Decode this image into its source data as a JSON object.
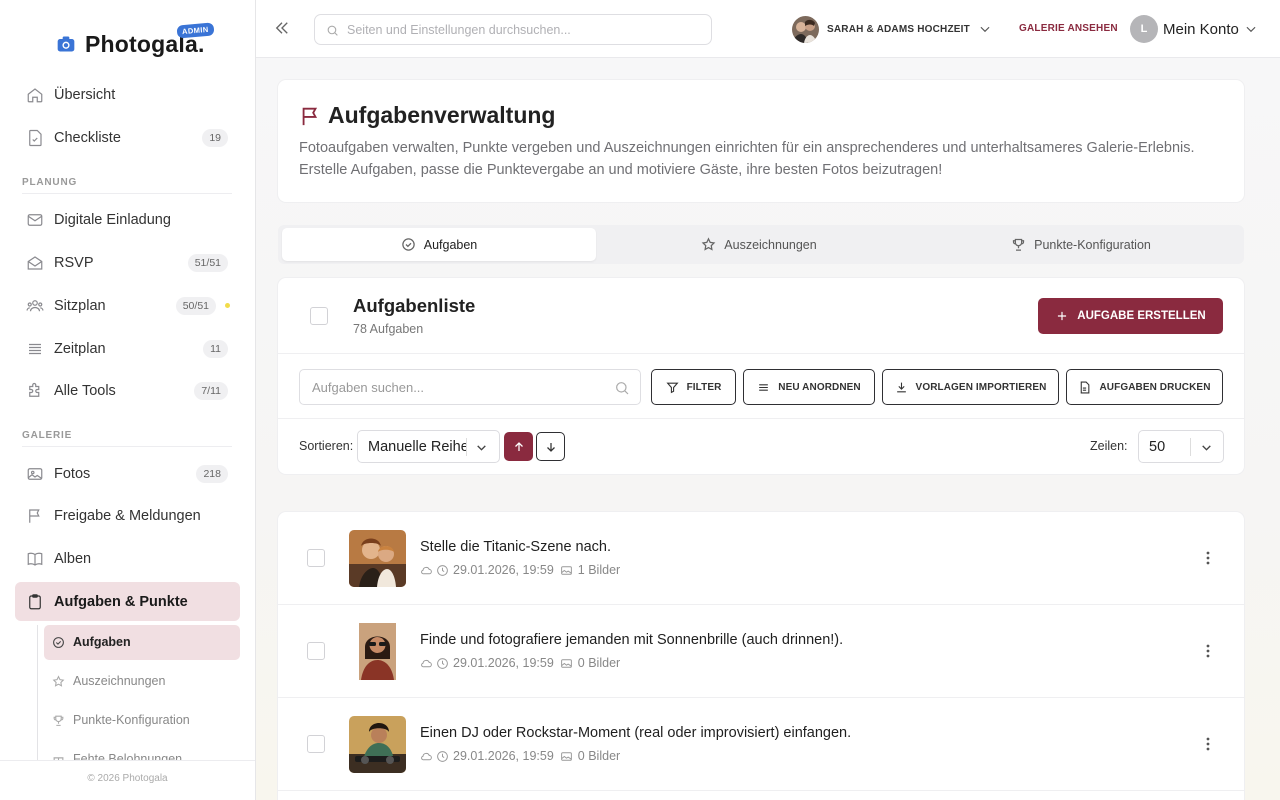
{
  "brand": {
    "name": "Photogala.",
    "badge": "ADMIN"
  },
  "sidebar": {
    "items_top": [
      {
        "label": "Übersicht",
        "icon": "home-icon"
      },
      {
        "label": "Checkliste",
        "icon": "checklist-icon",
        "count": "19"
      }
    ],
    "section_planung": "PLANUNG",
    "items_planung": [
      {
        "label": "Digitale Einladung",
        "icon": "mail-icon"
      },
      {
        "label": "RSVP",
        "icon": "envelope-open-icon",
        "count": "51/51"
      },
      {
        "label": "Sitzplan",
        "icon": "users-icon",
        "count": "50/51"
      },
      {
        "label": "Zeitplan",
        "icon": "list-icon",
        "count": "11"
      },
      {
        "label": "Alle Tools",
        "icon": "puzzle-icon",
        "count": "7/11"
      }
    ],
    "section_galerie": "GALERIE",
    "items_galerie": [
      {
        "label": "Fotos",
        "icon": "image-icon",
        "count": "218"
      },
      {
        "label": "Freigabe & Meldungen",
        "icon": "flag-icon"
      },
      {
        "label": "Alben",
        "icon": "book-icon"
      },
      {
        "label": "Aufgaben & Punkte",
        "icon": "clipboard-icon"
      }
    ],
    "sub_items": [
      {
        "label": "Aufgaben",
        "icon": "check-circle-icon"
      },
      {
        "label": "Auszeichnungen",
        "icon": "star-icon"
      },
      {
        "label": "Punkte-Konfiguration",
        "icon": "trophy-icon"
      },
      {
        "label": "Fehte Belohnungen",
        "icon": "gift-icon"
      }
    ],
    "footer": "© 2026 Photogala"
  },
  "header": {
    "search_placeholder": "Seiten und Einstellungen durchsuchen...",
    "event_name": "SARAH & ADAMS HOCHZEIT",
    "view_gallery": "GALERIE ANSEHEN",
    "account_initial": "L",
    "account_label": "Mein Konto"
  },
  "intro": {
    "title": "Aufgabenverwaltung",
    "description": "Fotoaufgaben verwalten, Punkte vergeben und Auszeichnungen einrichten für ein ansprechenderes und unterhaltsameres Galerie-Erlebnis. Erstelle Aufgaben, passe die Punktevergabe an und motiviere Gäste, ihre besten Fotos beizutragen!"
  },
  "tabs": [
    {
      "label": "Aufgaben",
      "icon": "check-circle-icon"
    },
    {
      "label": "Auszeichnungen",
      "icon": "star-icon"
    },
    {
      "label": "Punkte-Konfiguration",
      "icon": "trophy-icon"
    }
  ],
  "list": {
    "title": "Aufgabenliste",
    "count_text": "78 Aufgaben",
    "create_label": "AUFGABE ERSTELLEN",
    "search_placeholder": "Aufgaben suchen...",
    "buttons": {
      "filter": "FILTER",
      "reorder": "NEU ANORDNEN",
      "import": "VORLAGEN IMPORTIEREN",
      "print": "AUFGABEN DRUCKEN"
    },
    "sort_label": "Sortieren:",
    "sort_value": "Manuelle Reihenfolge",
    "rows_label": "Zeilen:",
    "rows_value": "50"
  },
  "tasks": [
    {
      "title": "Stelle die Titanic-Szene nach.",
      "date": "29.01.2026, 19:59",
      "images": "1 Bilder"
    },
    {
      "title": "Finde und fotografiere jemanden mit Sonnenbrille (auch drinnen!).",
      "date": "29.01.2026, 19:59",
      "images": "0 Bilder"
    },
    {
      "title": "Einen DJ oder Rockstar-Moment (real oder improvisiert) einfangen.",
      "date": "29.01.2026, 19:59",
      "images": "0 Bilder"
    }
  ],
  "colors": {
    "accent": "#8a2a3f",
    "active_bg": "#f1dfe2",
    "badge": "#3a74d6"
  }
}
